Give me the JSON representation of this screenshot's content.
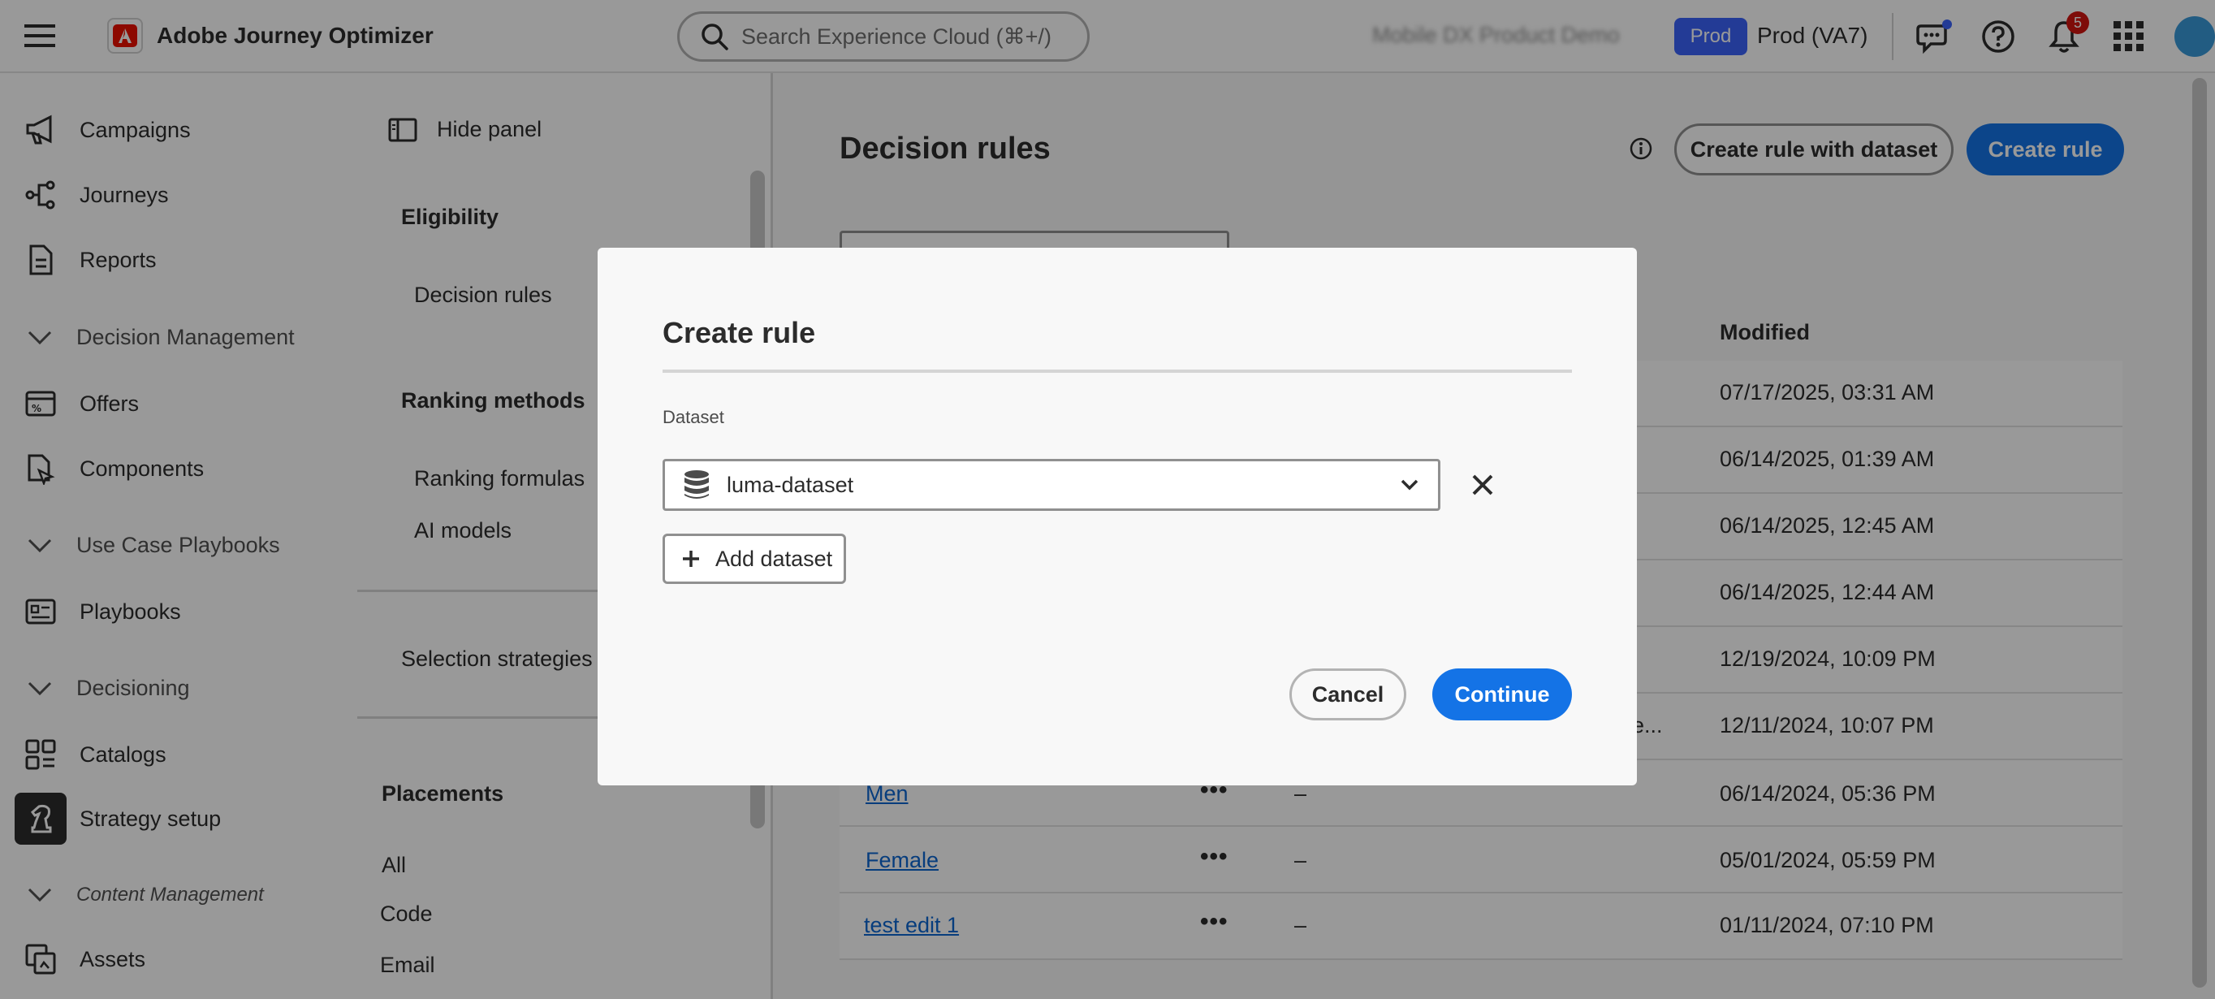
{
  "header": {
    "app_title": "Adobe Journey Optimizer",
    "search_placeholder": "Search Experience Cloud (⌘+/)",
    "org_name": "Mobile DX Product Demo",
    "env_badge": "Prod",
    "env_name": "Prod (VA7)",
    "notification_count": "5"
  },
  "sidebar": {
    "items": [
      {
        "label": "Campaigns"
      },
      {
        "label": "Journeys"
      },
      {
        "label": "Reports"
      },
      {
        "label": "Offers"
      },
      {
        "label": "Components"
      },
      {
        "label": "Playbooks"
      },
      {
        "label": "Catalogs"
      },
      {
        "label": "Strategy setup"
      },
      {
        "label": "Assets"
      }
    ],
    "groups": [
      {
        "label": "Decision Management"
      },
      {
        "label": "Use Case Playbooks"
      },
      {
        "label": "Decisioning"
      },
      {
        "label": "Content Management"
      }
    ]
  },
  "panel": {
    "hide_label": "Hide panel",
    "eligibility_heading": "Eligibility",
    "decision_rules": "Decision rules",
    "ranking_heading": "Ranking methods",
    "ranking_formulas": "Ranking formulas",
    "ai_models": "AI models",
    "selection_strategies": "Selection strategies",
    "placements_heading": "Placements",
    "placements": [
      "All",
      "Code",
      "Email"
    ]
  },
  "main": {
    "page_title": "Decision rules",
    "create_with_dataset": "Create rule with dataset",
    "create_rule": "Create rule",
    "modified_header": "Modified",
    "truncated_cell": "e...",
    "rows": [
      {
        "name": "",
        "date": "07/17/2025, 03:31 AM"
      },
      {
        "name": "",
        "date": "06/14/2025, 01:39 AM"
      },
      {
        "name": "",
        "date": "06/14/2025, 12:45 AM"
      },
      {
        "name": "",
        "date": "06/14/2025, 12:44 AM"
      },
      {
        "name": "",
        "date": "12/19/2024, 10:09 PM"
      },
      {
        "name": "",
        "date": "12/11/2024, 10:07 PM"
      },
      {
        "name": "Men",
        "date": "06/14/2024, 05:36 PM",
        "desc": "–"
      },
      {
        "name": "Female",
        "date": "05/01/2024, 05:59 PM",
        "desc": "–"
      },
      {
        "name": "test edit 1",
        "date": "01/11/2024, 07:10 PM",
        "desc": "–"
      }
    ]
  },
  "modal": {
    "title": "Create rule",
    "dataset_label": "Dataset",
    "dataset_value": "luma-dataset",
    "add_dataset": "Add dataset",
    "cancel": "Cancel",
    "continue": "Continue"
  },
  "colors": {
    "accent": "#1473e6",
    "link": "#0d66d0",
    "brand_red": "#eb1000",
    "badge_blue": "#3b63fb"
  }
}
